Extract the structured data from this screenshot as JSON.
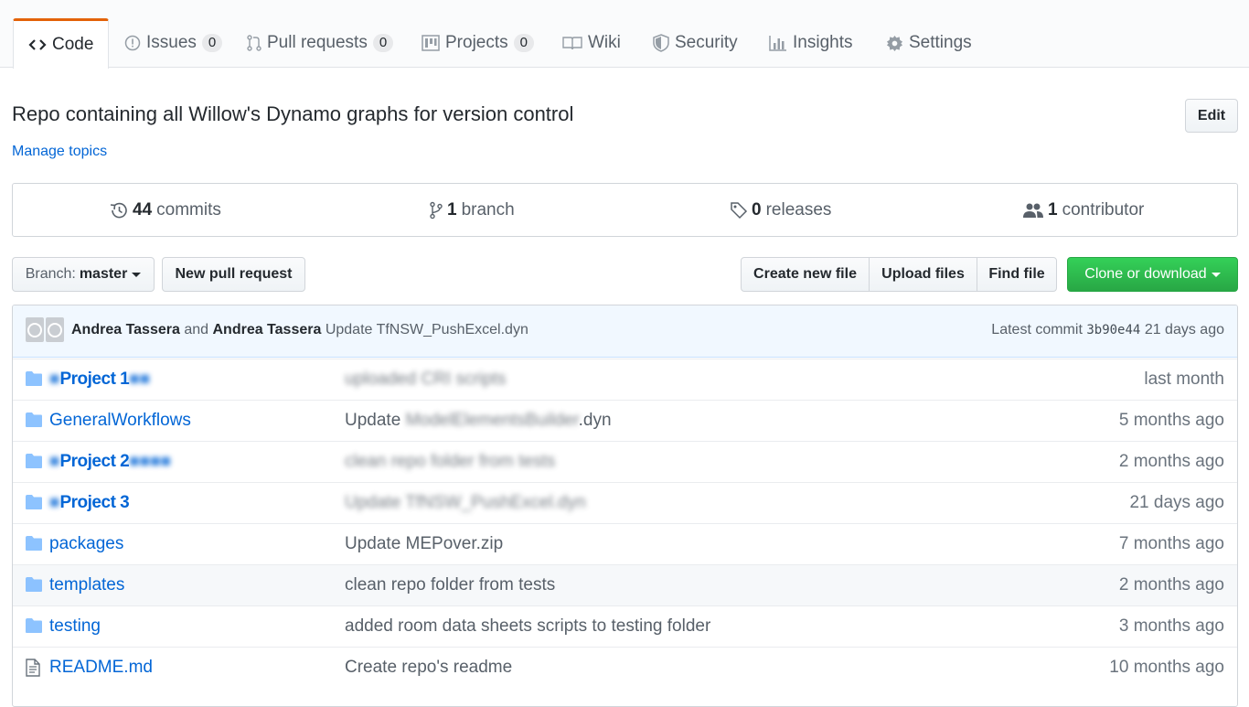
{
  "tabs": [
    {
      "label": "Code",
      "icon": "code-icon",
      "count": null
    },
    {
      "label": "Issues",
      "icon": "issue-icon",
      "count": "0"
    },
    {
      "label": "Pull requests",
      "icon": "pull-request-icon",
      "count": "0"
    },
    {
      "label": "Projects",
      "icon": "project-icon",
      "count": "0"
    },
    {
      "label": "Wiki",
      "icon": "book-icon",
      "count": null
    },
    {
      "label": "Security",
      "icon": "shield-icon",
      "count": null
    },
    {
      "label": "Insights",
      "icon": "graph-icon",
      "count": null
    },
    {
      "label": "Settings",
      "icon": "gear-icon",
      "count": null
    }
  ],
  "repo": {
    "description": "Repo containing all Willow's Dynamo graphs for version control",
    "manage_topics": "Manage topics",
    "edit_label": "Edit"
  },
  "summary": {
    "commits_num": "44",
    "commits_label": "commits",
    "branches_num": "1",
    "branches_label": "branch",
    "releases_num": "0",
    "releases_label": "releases",
    "contributors_num": "1",
    "contributors_label": "contributor"
  },
  "toolbar": {
    "branch_label": "Branch:",
    "branch_value": "master",
    "new_pr": "New pull request",
    "create_file": "Create new file",
    "upload_files": "Upload files",
    "find_file": "Find file",
    "clone": "Clone or download"
  },
  "commit": {
    "author1": "Andrea Tassera",
    "and": "and",
    "author2": "Andrea Tassera",
    "message": "Update TfNSW_PushExcel.dyn",
    "latest_label": "Latest commit",
    "sha": "3b90e44",
    "age": "21 days ago"
  },
  "files": [
    {
      "type": "dir",
      "name": "Project 1",
      "redacted": true,
      "message": "uploaded CRI scripts",
      "age": "last month"
    },
    {
      "type": "dir",
      "name": "GeneralWorkflows",
      "redacted": false,
      "message_pre": "Update",
      "message_blur": "ModelElementsBuilder",
      "message_post": ".dyn",
      "age": "5 months ago"
    },
    {
      "type": "dir",
      "name": "Project 2",
      "redacted": true,
      "message": "clean repo folder from tests",
      "age": "2 months ago"
    },
    {
      "type": "dir",
      "name": "Project 3",
      "redacted": true,
      "message": "Update TfNSW_PushExcel.dyn",
      "age": "21 days ago"
    },
    {
      "type": "dir",
      "name": "packages",
      "redacted": false,
      "message": "Update MEPover.zip",
      "age": "7 months ago"
    },
    {
      "type": "dir",
      "name": "templates",
      "redacted": false,
      "message": "clean repo folder from tests",
      "age": "2 months ago"
    },
    {
      "type": "dir",
      "name": "testing",
      "redacted": false,
      "message": "added room data sheets scripts to testing folder",
      "age": "3 months ago"
    },
    {
      "type": "file",
      "name": "README.md",
      "redacted": false,
      "message": "Create repo's readme",
      "age": "10 months ago"
    }
  ],
  "colors": {
    "accent_tab": "#e36209",
    "link": "#0366d6",
    "clone_green": "#28a745",
    "commit_bg": "#f1f8ff",
    "folder": "#79b8ff"
  }
}
